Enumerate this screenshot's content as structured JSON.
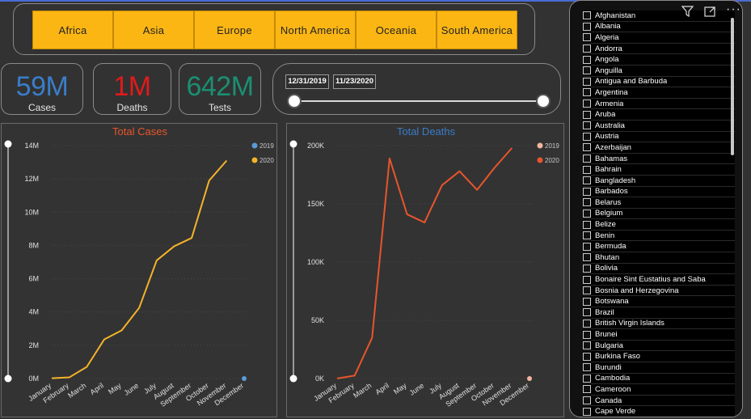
{
  "regions": [
    "Africa",
    "Asia",
    "Europe",
    "North America",
    "Oceania",
    "South America"
  ],
  "kpis": [
    {
      "value": "59M",
      "label": "Cases",
      "color": "#3a7dc9"
    },
    {
      "value": "1M",
      "label": "Deaths",
      "color": "#e01b1b"
    },
    {
      "value": "642M",
      "label": "Tests",
      "color": "#1b8f73"
    }
  ],
  "date_range": {
    "start": "12/31/2019",
    "end": "11/23/2020"
  },
  "countries": [
    "Afghanistan",
    "Albania",
    "Algeria",
    "Andorra",
    "Angola",
    "Anguilla",
    "Antigua and Barbuda",
    "Argentina",
    "Armenia",
    "Aruba",
    "Australia",
    "Austria",
    "Azerbaijan",
    "Bahamas",
    "Bahrain",
    "Bangladesh",
    "Barbados",
    "Belarus",
    "Belgium",
    "Belize",
    "Benin",
    "Bermuda",
    "Bhutan",
    "Bolivia",
    "Bonaire Sint Eustatius and Saba",
    "Bosnia and Herzegovina",
    "Botswana",
    "Brazil",
    "British Virgin Islands",
    "Brunei",
    "Bulgaria",
    "Burkina Faso",
    "Burundi",
    "Cambodia",
    "Cameroon",
    "Canada",
    "Cape Verde"
  ],
  "icons": {
    "filter": "filter-icon",
    "focus": "focus-mode-icon",
    "more": "more-options-icon"
  },
  "chart_data": [
    {
      "type": "line",
      "title": "Total Cases",
      "title_color": "#e8552c",
      "categories": [
        "January",
        "February",
        "March",
        "April",
        "May",
        "June",
        "July",
        "August",
        "September",
        "October",
        "November",
        "December"
      ],
      "ylim": [
        0,
        14000000
      ],
      "yticks": [
        0,
        2000000,
        4000000,
        6000000,
        8000000,
        10000000,
        12000000,
        14000000
      ],
      "ytick_labels": [
        "0M",
        "2M",
        "4M",
        "6M",
        "8M",
        "10M",
        "12M",
        "14M"
      ],
      "legend": [
        "2019",
        "2020"
      ],
      "legend_colors": [
        "#5b9bd5",
        "#f5b32a"
      ],
      "legend_position": "top-right",
      "series": [
        {
          "name": "2019",
          "color": "#5b9bd5",
          "values": [
            null,
            null,
            null,
            null,
            null,
            null,
            null,
            null,
            null,
            null,
            null,
            0
          ]
        },
        {
          "name": "2020",
          "color": "#f5b32a",
          "values": [
            20000,
            70000,
            700000,
            2350000,
            2900000,
            4250000,
            7100000,
            7950000,
            8450000,
            11900000,
            13100000,
            null
          ]
        }
      ]
    },
    {
      "type": "line",
      "title": "Total Deaths",
      "title_color": "#3a7dc9",
      "categories": [
        "January",
        "February",
        "March",
        "April",
        "May",
        "June",
        "July",
        "August",
        "September",
        "October",
        "November",
        "December"
      ],
      "ylim": [
        0,
        200000
      ],
      "yticks": [
        0,
        50000,
        100000,
        150000,
        200000
      ],
      "ytick_labels": [
        "0K",
        "50K",
        "100K",
        "150K",
        "200K"
      ],
      "legend": [
        "2019",
        "2020"
      ],
      "legend_colors": [
        "#f4b6a0",
        "#e8552c"
      ],
      "legend_position": "top-right",
      "series": [
        {
          "name": "2019",
          "color": "#f4b6a0",
          "values": [
            null,
            null,
            null,
            null,
            null,
            null,
            null,
            null,
            null,
            null,
            null,
            0
          ]
        },
        {
          "name": "2020",
          "color": "#e8552c",
          "values": [
            100,
            2500,
            35000,
            189000,
            141000,
            134000,
            166000,
            178000,
            162000,
            181000,
            198000,
            null
          ]
        }
      ]
    }
  ]
}
